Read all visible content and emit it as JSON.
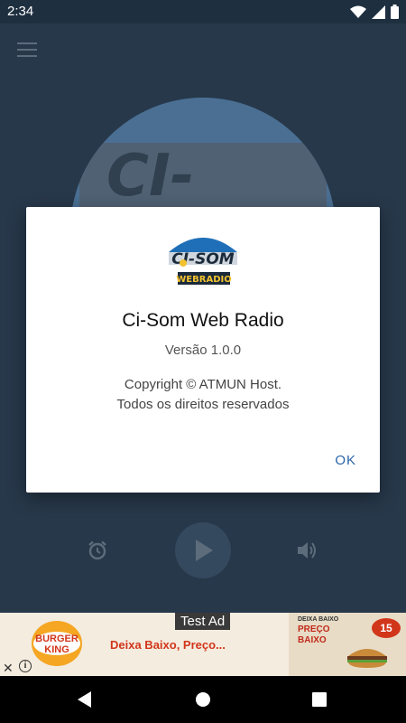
{
  "status_bar": {
    "time": "2:34",
    "icons": [
      "wifi-icon",
      "signal-icon",
      "battery-icon"
    ]
  },
  "app": {
    "background_logo_text": "CI-SOM",
    "controls": {
      "alarm_icon": "alarm-icon",
      "play_icon": "play-icon",
      "volume_icon": "volume-icon"
    }
  },
  "dialog": {
    "logo_top_text": "CI-SOM",
    "logo_bottom_text": "WEBRADIO",
    "title": "Ci-Som Web Radio",
    "version": "Versão 1.0.0",
    "copyright_line1": "Copyright © ATMUN Host.",
    "copyright_line2": "Todos os direitos reservados",
    "ok_label": "OK"
  },
  "ad": {
    "test_label": "Test Ad",
    "brand_line1": "BURGER",
    "brand_line2": "KING",
    "headline": "Deixa Baixo, Preço...",
    "promo_line1": "DEIXA BAIXO",
    "promo_line2": "PREÇO",
    "promo_line3": "BAIXO",
    "price": "15",
    "close_symbol": "✕",
    "info_symbol": "i"
  },
  "colors": {
    "accent": "#2a64a8",
    "background": "#2c3e50",
    "ad_red": "#d2361a"
  }
}
